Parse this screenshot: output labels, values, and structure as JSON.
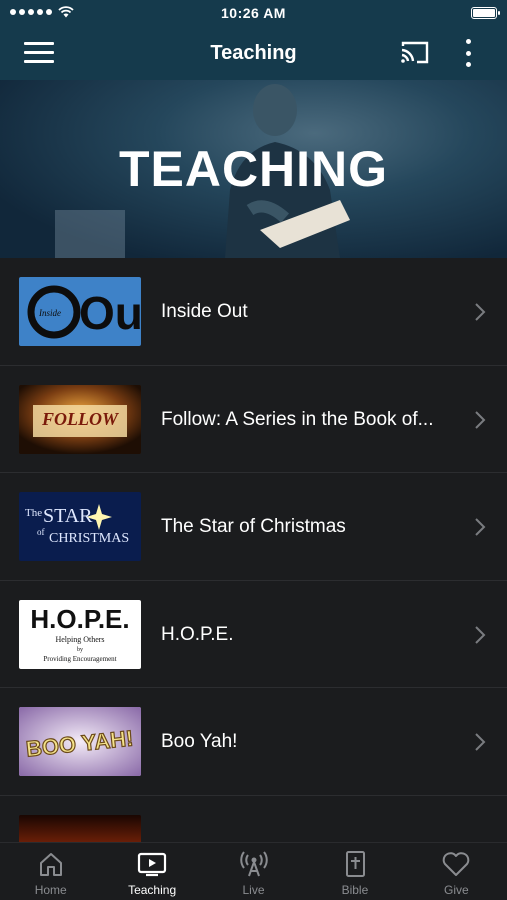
{
  "status_bar": {
    "time": "10:26 AM"
  },
  "nav": {
    "title": "Teaching"
  },
  "hero": {
    "title": "TEACHING"
  },
  "items": [
    {
      "title": "Inside Out",
      "thumb_text": "Out",
      "thumb_subtext": "Inside"
    },
    {
      "title": "Follow: A Series in the Book of...",
      "thumb_text": "FOLLOW"
    },
    {
      "title": "The Star of Christmas",
      "thumb_text_1": "The",
      "thumb_text_2": "STAR",
      "thumb_text_3": "of",
      "thumb_text_4": "CHRISTMAS"
    },
    {
      "title": "H.O.P.E.",
      "thumb_text": "H.O.P.E.",
      "thumb_line_1": "Helping Others",
      "thumb_line_2": "by",
      "thumb_line_3": "Providing Encouragement"
    },
    {
      "title": "Boo Yah!",
      "thumb_text": "BOO YAH!"
    },
    {
      "title": ""
    }
  ],
  "tabs": [
    {
      "label": "Home",
      "icon": "home-icon",
      "active": false
    },
    {
      "label": "Teaching",
      "icon": "play-screen-icon",
      "active": true
    },
    {
      "label": "Live",
      "icon": "broadcast-icon",
      "active": false
    },
    {
      "label": "Bible",
      "icon": "bible-icon",
      "active": false
    },
    {
      "label": "Give",
      "icon": "heart-icon",
      "active": false
    }
  ],
  "colors": {
    "nav_bg": "#153a4c",
    "list_bg": "#1b1c1e",
    "tab_inactive": "#8a8c90",
    "tab_active": "#ffffff"
  }
}
